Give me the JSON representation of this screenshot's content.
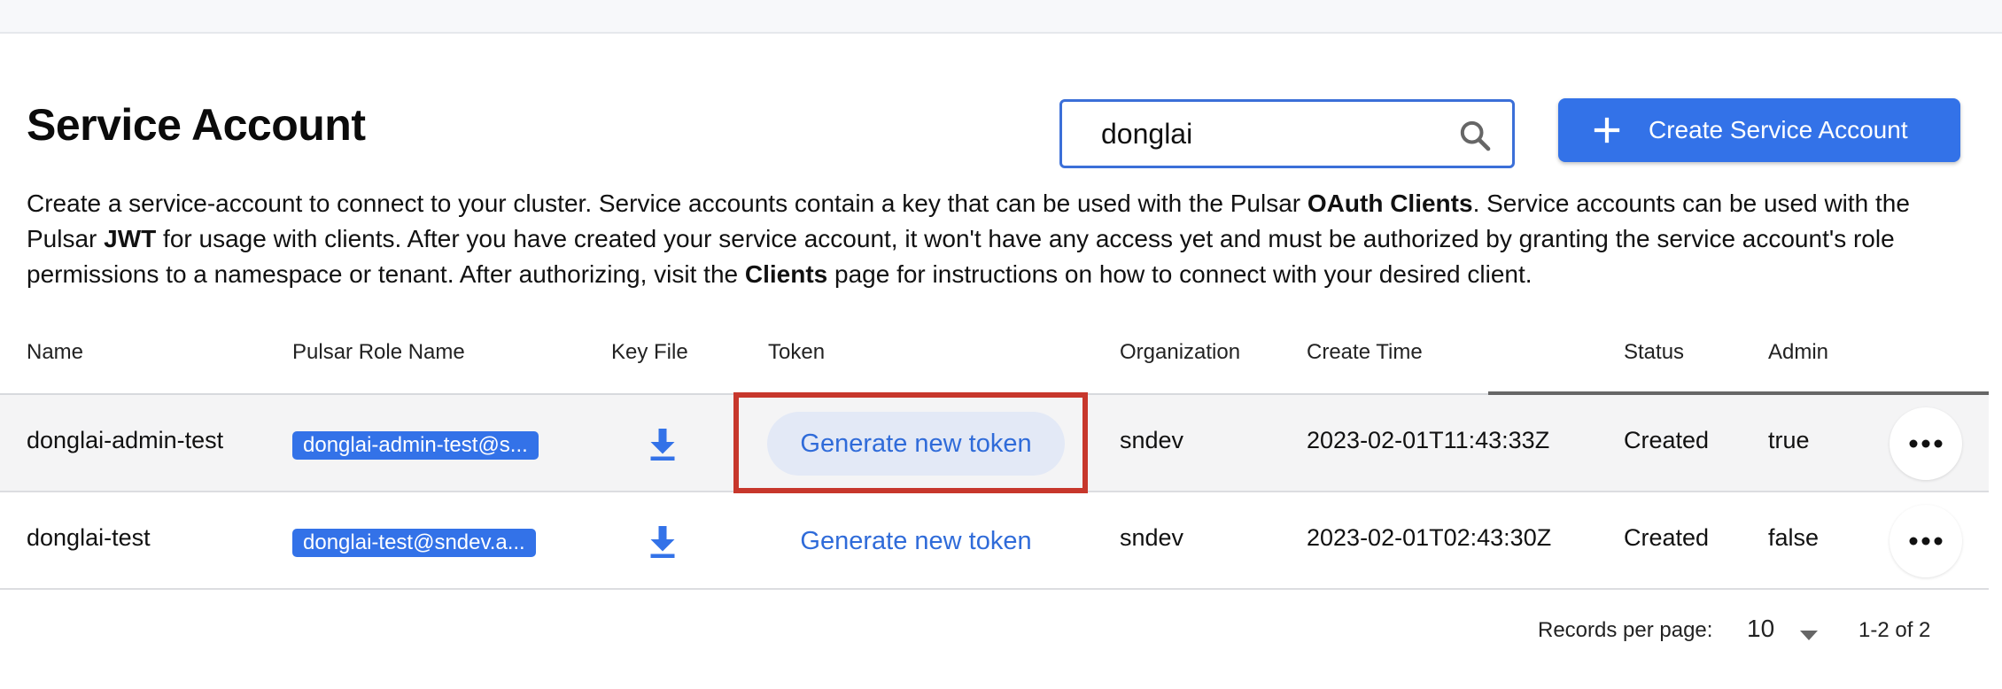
{
  "page": {
    "title": "Service Account"
  },
  "search": {
    "value": "donglai"
  },
  "create_button": {
    "label": "Create Service Account"
  },
  "description": {
    "p1": "Create a service-account to connect to your cluster. Service accounts contain a key that can be used with the Pulsar ",
    "b1": "OAuth Clients",
    "p2": ". Service accounts can be used with the Pulsar ",
    "b2": "JWT",
    "p3": " for usage with clients. After you have created your service account, it won't have any access yet and must be authorized by granting the service account's role permissions to a namespace or tenant. After authorizing, visit the ",
    "b3": "Clients",
    "p4": " page for instructions on how to connect with your desired client."
  },
  "table": {
    "columns": [
      "Name",
      "Pulsar Role Name",
      "Key File",
      "Token",
      "Organization",
      "Create Time",
      "Status",
      "Admin"
    ],
    "rows": [
      {
        "name": "donglai-admin-test",
        "role": "donglai-admin-test@s...",
        "token_action": "Generate new token",
        "organization": "sndev",
        "create_time": "2023-02-01T11:43:33Z",
        "status": "Created",
        "admin": "true"
      },
      {
        "name": "donglai-test",
        "role": "donglai-test@sndev.a...",
        "token_action": "Generate new token",
        "organization": "sndev",
        "create_time": "2023-02-01T02:43:30Z",
        "status": "Created",
        "admin": "false"
      }
    ]
  },
  "pagination": {
    "records_label": "Records per page:",
    "per_page": "10",
    "range": "1-2 of 2"
  },
  "icons": {
    "search": "search-icon",
    "plus": "plus-icon",
    "download": "download-icon",
    "more": "more-horizontal-icon",
    "dropdown": "caret-down-icon"
  },
  "colors": {
    "accent": "#3372e8",
    "highlight": "#c7372c",
    "token_link": "#2f6bd9"
  }
}
